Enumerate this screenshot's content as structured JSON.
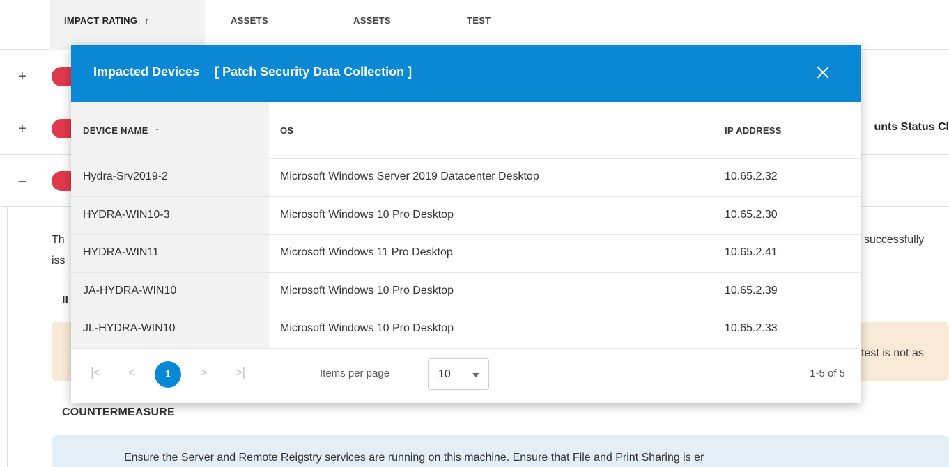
{
  "background": {
    "columns": {
      "impact_rating": "IMPACT RATING",
      "sort_arrow": "↑",
      "assets_1": "ASSETS",
      "assets_2": "ASSETS",
      "test": "TEST"
    },
    "rows": [
      {
        "toggle": "+",
        "tail_text": ""
      },
      {
        "toggle": "+",
        "tail_text": "unts Status Cl"
      },
      {
        "toggle": "–",
        "tail_text": ""
      }
    ],
    "fragments": {
      "th": "Th",
      "iss": "iss",
      "successfully": "successfully",
      "ii": "II",
      "impact_tail": "test is not as"
    },
    "countermeasure_title": "COUNTERMEASURE",
    "countermeasure_text": "Ensure the Server and Remote Reigstry services are running on this machine. Ensure that File and Print Sharing is er",
    "colors": {
      "impact_pill": "#e0394b",
      "impact_box": "#f8ead7",
      "countermeasure_box": "#e3eef7"
    }
  },
  "modal": {
    "title": "Impacted Devices",
    "subtitle": "[ Patch Security Data Collection ]",
    "close_icon": "close-icon",
    "header_color": "#0a88d4",
    "table": {
      "headers": {
        "device_name": "DEVICE NAME",
        "sort_arrow": "↑",
        "os": "OS",
        "ip_address": "IP ADDRESS"
      },
      "rows": [
        {
          "device": "Hydra-Srv2019-2",
          "os": "Microsoft Windows Server 2019 Datacenter Desktop",
          "ip": "10.65.2.32"
        },
        {
          "device": "HYDRA-WIN10-3",
          "os": "Microsoft Windows 10 Pro Desktop",
          "ip": "10.65.2.30"
        },
        {
          "device": "HYDRA-WIN11",
          "os": "Microsoft Windows 11 Pro Desktop",
          "ip": "10.65.2.41"
        },
        {
          "device": "JA-HYDRA-WIN10",
          "os": "Microsoft Windows 10 Pro Desktop",
          "ip": "10.65.2.39"
        },
        {
          "device": "JL-HYDRA-WIN10",
          "os": "Microsoft Windows 10 Pro Desktop",
          "ip": "10.65.2.33"
        }
      ]
    },
    "pagination": {
      "first": "|<",
      "prev": "<",
      "current_page": "1",
      "next": ">",
      "last": ">|",
      "items_per_page_label": "Items per page",
      "items_per_page_value": "10",
      "range_label": "1-5 of 5"
    }
  }
}
